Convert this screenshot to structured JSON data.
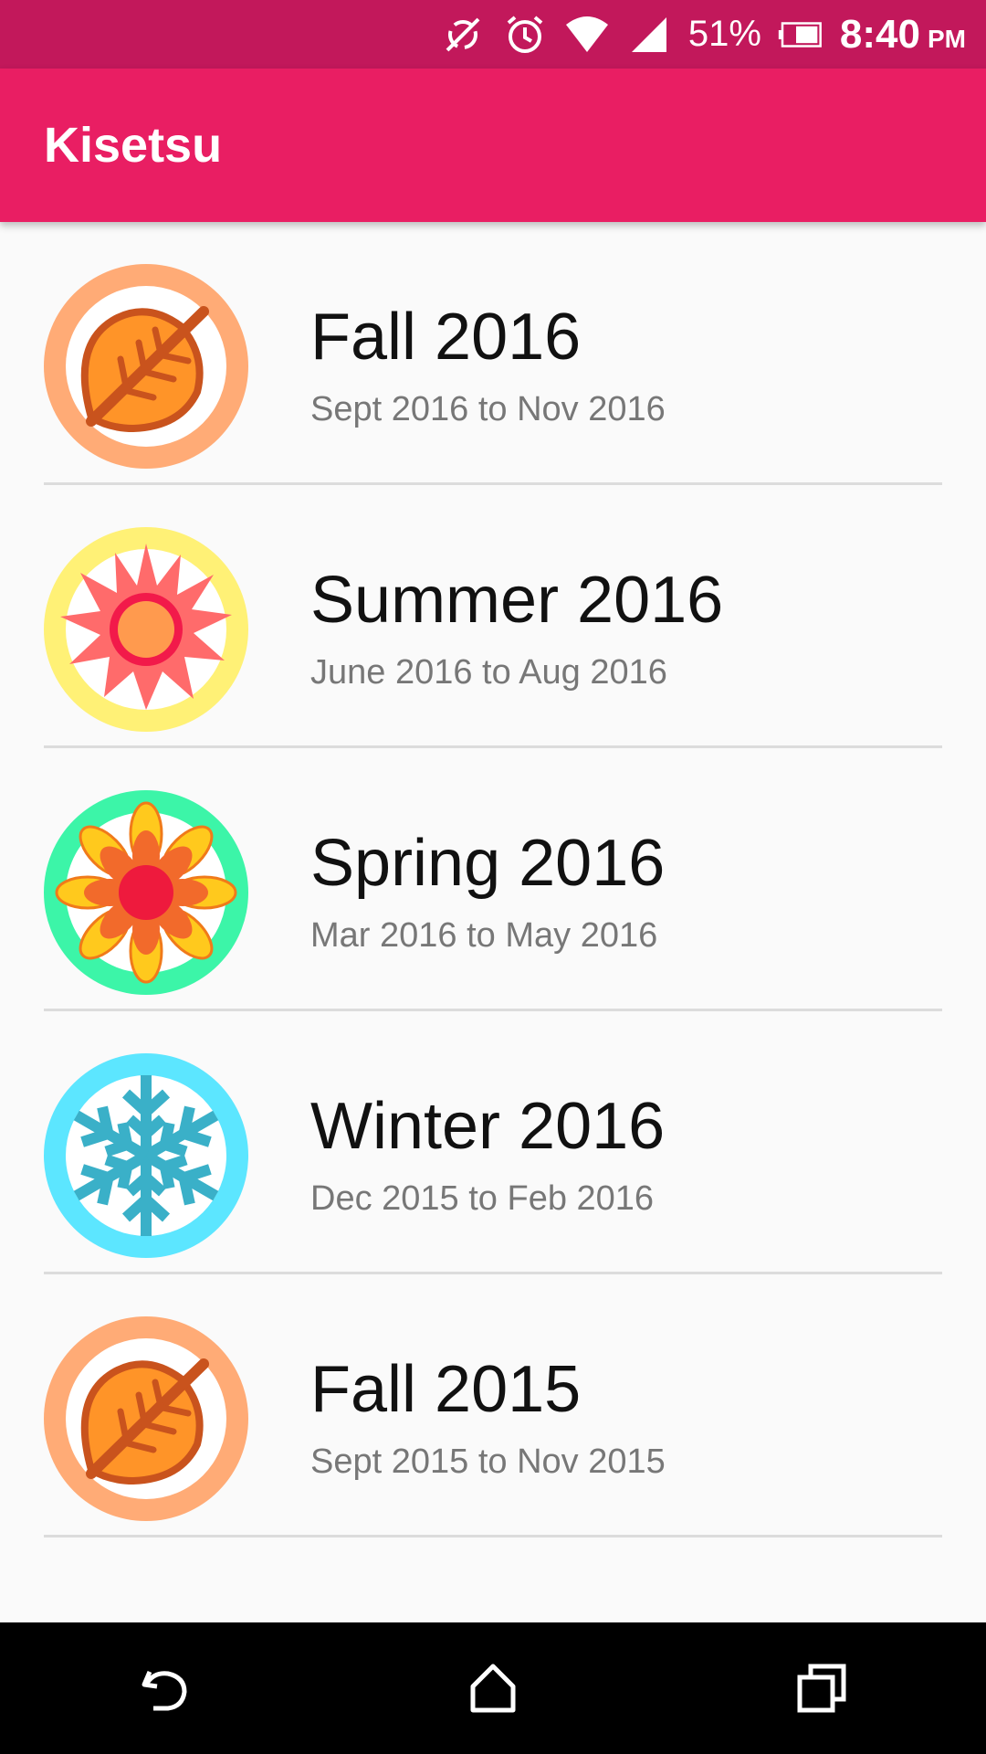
{
  "status_bar": {
    "battery_percent": "51%",
    "time": "8:40",
    "ampm": "PM",
    "icons": [
      "sync-off-icon",
      "alarm-icon",
      "wifi-icon",
      "signal-icon",
      "battery-icon"
    ]
  },
  "app_bar": {
    "title": "Kisetsu"
  },
  "seasons": [
    {
      "title": "Fall 2016",
      "range": "Sept 2016 to Nov 2016",
      "icon": "fall-leaf-icon"
    },
    {
      "title": "Summer 2016",
      "range": "June 2016 to Aug 2016",
      "icon": "summer-sun-icon"
    },
    {
      "title": "Spring 2016",
      "range": "Mar 2016 to May 2016",
      "icon": "spring-flower-icon"
    },
    {
      "title": "Winter 2016",
      "range": "Dec 2015 to Feb 2016",
      "icon": "winter-snowflake-icon"
    },
    {
      "title": "Fall 2015",
      "range": "Sept 2015 to Nov 2015",
      "icon": "fall-leaf-icon"
    }
  ],
  "colors": {
    "status_bar": "#c2185b",
    "app_bar": "#e91e63",
    "fall_ring": "#ffab76",
    "summer_ring": "#fff176",
    "spring_ring": "#3cf5a8",
    "winter_ring": "#5ce6ff"
  },
  "nav_bar": {
    "icons": [
      "back-icon",
      "home-icon",
      "recents-icon"
    ]
  }
}
